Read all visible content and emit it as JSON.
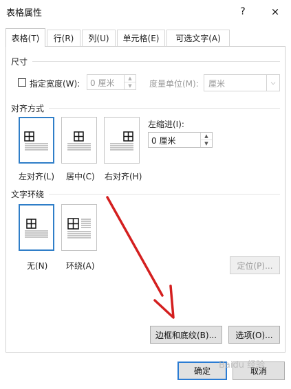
{
  "window": {
    "title": "表格属性",
    "help": "?",
    "close": "×"
  },
  "tabs": [
    {
      "label": "表格(T)",
      "active": true
    },
    {
      "label": "行(R)",
      "active": false
    },
    {
      "label": "列(U)",
      "active": false
    },
    {
      "label": "单元格(E)",
      "active": false
    },
    {
      "label": "可选文字(A)",
      "active": false
    }
  ],
  "size": {
    "title": "尺寸",
    "specify_width_label": "指定宽度(W):",
    "width_value": "0 厘米",
    "unit_label": "度量单位(M):",
    "unit_value": "厘米"
  },
  "alignment": {
    "title": "对齐方式",
    "options": [
      "左对齐(L)",
      "居中(C)",
      "右对齐(H)"
    ],
    "indent_label": "左缩进(I):",
    "indent_value": "0 厘米"
  },
  "wrapping": {
    "title": "文字环绕",
    "options": [
      "无(N)",
      "环绕(A)"
    ],
    "position_button": "定位(P)..."
  },
  "buttons": {
    "borders": "边框和底纹(B)...",
    "options": "选项(O)...",
    "ok": "确定",
    "cancel": "取消"
  },
  "watermark": "Baidu 经验",
  "colors": {
    "selection": "#2f7ec8",
    "arrow": "#d41f1f"
  }
}
